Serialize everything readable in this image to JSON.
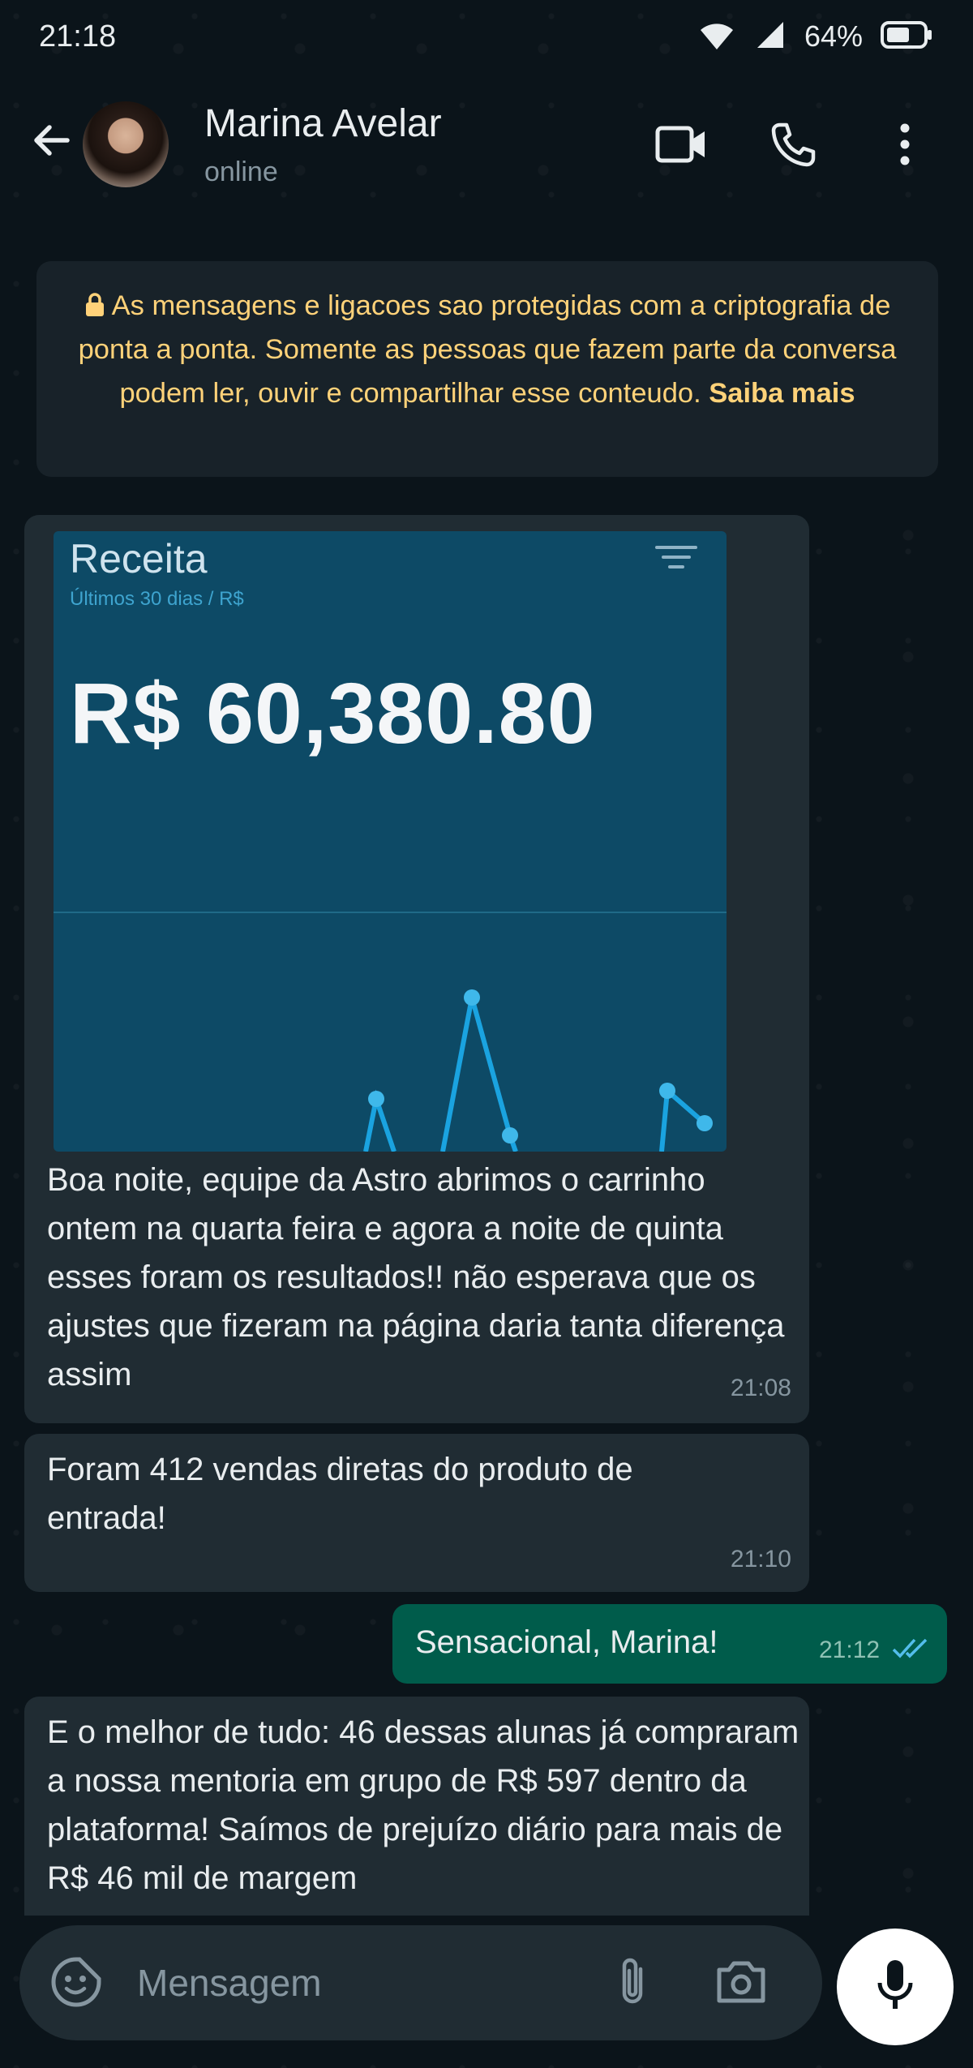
{
  "status_bar": {
    "time": "21:18",
    "battery_percent": "64%",
    "battery_level": 0.64,
    "icons": [
      "wifi-icon",
      "signal-icon",
      "battery-icon"
    ]
  },
  "header": {
    "contact_name": "Marina Avelar",
    "contact_status": "online",
    "icons": [
      "back-arrow-icon",
      "video-call-icon",
      "phone-icon",
      "more-vert-icon"
    ]
  },
  "encryption_notice": {
    "text": "As mensagens e ligacoes sao protegidas com a criptografia de ponta a ponta. Somente as pessoas que fazem parte da conversa podem ler, ouvir e compartilhar esse conteudo.",
    "link": "Saiba mais"
  },
  "messages": [
    {
      "direction": "incoming",
      "image": {
        "title": "Receita",
        "subtitle": "Últimos 30 dias / R$",
        "value": "R$ 60,380.80"
      },
      "text": "Boa noite, equipe da Astro abrimos o carrinho ontem na quarta feira e agora a noite de quinta esses foram os resultados!! não esperava que os ajustes que fizeram na página daria tanta diferença assim",
      "time": "21:08"
    },
    {
      "direction": "incoming",
      "text": "Foram 412 vendas diretas do produto de entrada!",
      "time": "21:10"
    },
    {
      "direction": "outgoing",
      "text": "Sensacional, Marina!",
      "time": "21:12",
      "status": "read"
    },
    {
      "direction": "incoming",
      "text": "E o melhor de tudo: 46 dessas alunas já compraram a nossa mentoria em grupo de R$ 597 dentro da plataforma! Saímos de prejuízo diário para mais de R$ 46 mil de margem",
      "time": ""
    }
  ],
  "composer": {
    "placeholder": "Mensagem",
    "icons": [
      "emoji-sticker-icon",
      "attach-icon",
      "camera-icon",
      "mic-icon"
    ]
  },
  "colors": {
    "background": "#0b141a",
    "bubble_incoming": "#202c33",
    "bubble_outgoing": "#005c4b",
    "notice_text": "#ffd279",
    "read_ticks": "#53bdeb",
    "chart_bg": "#0d4a66",
    "chart_line": "#1aa3e0"
  }
}
